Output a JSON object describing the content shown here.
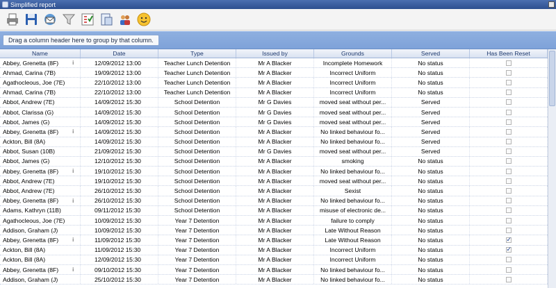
{
  "window": {
    "title": "Simplified report"
  },
  "toolbar": {
    "icons": [
      "printer-icon",
      "save-icon",
      "email-icon",
      "filter-icon",
      "checklist-icon",
      "export-icon",
      "users-icon",
      "smiley-icon"
    ]
  },
  "group_panel": {
    "hint": "Drag a column header here to group by that column."
  },
  "columns": [
    "Name",
    "Date",
    "Type",
    "Issued by",
    "Grounds",
    "Served",
    "Has Been Reset"
  ],
  "rows": [
    {
      "name": "Abbey, Grenetta (8F)",
      "info": "i",
      "date": "12/09/2012 13:00",
      "type": "Teacher Lunch Detention",
      "issued": "Mr A Blacker",
      "grounds": "Incomplete Homework",
      "served": "No status",
      "reset": false
    },
    {
      "name": "Ahmad, Carina (7B)",
      "info": "",
      "date": "19/09/2012 13:00",
      "type": "Teacher Lunch Detention",
      "issued": "Mr A Blacker",
      "grounds": "Incorrect Uniform",
      "served": "No status",
      "reset": false
    },
    {
      "name": "Agathocleous, Joe (7E)",
      "info": "",
      "date": "22/10/2012 13:00",
      "type": "Teacher Lunch Detention",
      "issued": "Mr A Blacker",
      "grounds": "Incorrect Uniform",
      "served": "No status",
      "reset": false
    },
    {
      "name": "Ahmad, Carina (7B)",
      "info": "",
      "date": "22/10/2012 13:00",
      "type": "Teacher Lunch Detention",
      "issued": "Mr A Blacker",
      "grounds": "Incorrect Uniform",
      "served": "No status",
      "reset": false
    },
    {
      "name": "Abbot, Andrew (7E)",
      "info": "",
      "date": "14/09/2012 15:30",
      "type": "School Detention",
      "issued": "Mr G Davies",
      "grounds": "moved seat without per...",
      "served": "Served",
      "reset": false
    },
    {
      "name": "Abbot, Clarissa (G)",
      "info": "",
      "date": "14/09/2012 15:30",
      "type": "School Detention",
      "issued": "Mr G Davies",
      "grounds": "moved seat without per...",
      "served": "Served",
      "reset": false
    },
    {
      "name": "Abbot, James (G)",
      "info": "",
      "date": "14/09/2012 15:30",
      "type": "School Detention",
      "issued": "Mr G Davies",
      "grounds": "moved seat without per...",
      "served": "Served",
      "reset": false
    },
    {
      "name": "Abbey, Grenetta (8F)",
      "info": "i",
      "date": "14/09/2012 15:30",
      "type": "School Detention",
      "issued": "Mr A Blacker",
      "grounds": "No linked behaviour fo...",
      "served": "Served",
      "reset": false
    },
    {
      "name": "Ackton, Bill (8A)",
      "info": "",
      "date": "14/09/2012 15:30",
      "type": "School Detention",
      "issued": "Mr A Blacker",
      "grounds": "No linked behaviour fo...",
      "served": "Served",
      "reset": false
    },
    {
      "name": "Abbot, Susan (10B)",
      "info": "",
      "date": "21/09/2012 15:30",
      "type": "School Detention",
      "issued": "Mr G Davies",
      "grounds": "moved seat without per...",
      "served": "Served",
      "reset": false
    },
    {
      "name": "Abbot, James (G)",
      "info": "",
      "date": "12/10/2012 15:30",
      "type": "School Detention",
      "issued": "Mr A Blacker",
      "grounds": "smoking",
      "served": "No status",
      "reset": false
    },
    {
      "name": "Abbey, Grenetta (8F)",
      "info": "i",
      "date": "19/10/2012 15:30",
      "type": "School Detention",
      "issued": "Mr A Blacker",
      "grounds": "No linked behaviour fo...",
      "served": "No status",
      "reset": false
    },
    {
      "name": "Abbot, Andrew (7E)",
      "info": "",
      "date": "19/10/2012 15:30",
      "type": "School Detention",
      "issued": "Mr A Blacker",
      "grounds": "moved seat without per...",
      "served": "No status",
      "reset": false
    },
    {
      "name": "Abbot, Andrew (7E)",
      "info": "",
      "date": "26/10/2012 15:30",
      "type": "School Detention",
      "issued": "Mr A Blacker",
      "grounds": "Sexist",
      "served": "No status",
      "reset": false
    },
    {
      "name": "Abbey, Grenetta (8F)",
      "info": "i",
      "date": "26/10/2012 15:30",
      "type": "School Detention",
      "issued": "Mr A Blacker",
      "grounds": "No linked behaviour fo...",
      "served": "No status",
      "reset": false
    },
    {
      "name": "Adams, Kathryn (11B)",
      "info": "",
      "date": "09/11/2012 15:30",
      "type": "School Detention",
      "issued": "Mr A Blacker",
      "grounds": "misuse of electronic de...",
      "served": "No status",
      "reset": false
    },
    {
      "name": "Agathocleous, Joe (7E)",
      "info": "",
      "date": "10/09/2012 15:30",
      "type": "Year 7 Detention",
      "issued": "Mr A Blacker",
      "grounds": "failure to comply",
      "served": "No status",
      "reset": false
    },
    {
      "name": "Addison, Graham (J)",
      "info": "",
      "date": "10/09/2012 15:30",
      "type": "Year 7 Detention",
      "issued": "Mr A Blacker",
      "grounds": "Late Without Reason",
      "served": "No status",
      "reset": false
    },
    {
      "name": "Abbey, Grenetta (8F)",
      "info": "i",
      "date": "11/09/2012 15:30",
      "type": "Year 7 Detention",
      "issued": "Mr A Blacker",
      "grounds": "Late Without Reason",
      "served": "No status",
      "reset": true
    },
    {
      "name": "Ackton, Bill (8A)",
      "info": "",
      "date": "11/09/2012 15:30",
      "type": "Year 7 Detention",
      "issued": "Mr A Blacker",
      "grounds": "Incorrect Uniform",
      "served": "No status",
      "reset": true
    },
    {
      "name": "Ackton, Bill (8A)",
      "info": "",
      "date": "12/09/2012 15:30",
      "type": "Year 7 Detention",
      "issued": "Mr A Blacker",
      "grounds": "Incorrect Uniform",
      "served": "No status",
      "reset": false
    },
    {
      "name": "Abbey, Grenetta (8F)",
      "info": "i",
      "date": "09/10/2012 15:30",
      "type": "Year 7 Detention",
      "issued": "Mr A Blacker",
      "grounds": "No linked behaviour fo...",
      "served": "No status",
      "reset": false
    },
    {
      "name": "Addison, Graham (J)",
      "info": "",
      "date": "25/10/2012 15:30",
      "type": "Year 7 Detention",
      "issued": "Mr A Blacker",
      "grounds": "No linked behaviour fo...",
      "served": "No status",
      "reset": false
    }
  ]
}
